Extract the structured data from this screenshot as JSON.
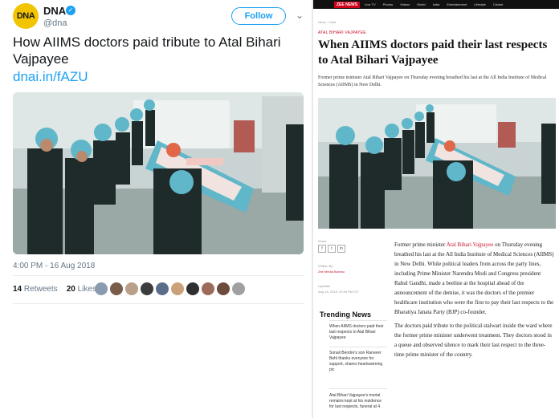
{
  "tweet": {
    "avatar_text": "DNA",
    "author_name": "DNA",
    "verified_glyph": "✓",
    "handle": "@dna",
    "follow_label": "Follow",
    "chevron_glyph": "⌄",
    "text": "How AIIMS doctors paid tribute to Atal Bihari Vajpayee",
    "link": "dnai.in/fAZU",
    "timestamp": "4:00 PM - 16 Aug 2018",
    "retweets_count": "14",
    "retweets_label": "Retweets",
    "likes_count": "20",
    "likes_label": "Likes",
    "liker_colors": [
      "#8a9bb0",
      "#7a5c4a",
      "#b8a08a",
      "#3c3c3c",
      "#5a6e8c",
      "#c9a27a",
      "#2f2f2f",
      "#9c6b5a",
      "#6d4c3d",
      "#a0a0a0"
    ]
  },
  "article": {
    "nav_logo": "ZEE NEWS",
    "nav_items": [
      "Live TV",
      "Photos",
      "Videos",
      "World",
      "India",
      "Entertainment",
      "Lifestyle",
      "Cricket"
    ],
    "breadcrumb": "News › India",
    "section": "ATAL BIHARI VAJPAYEE",
    "headline": "When AIIMS doctors paid their last respects to Atal Bihari Vajpayee",
    "summary": "Former prime minister Atal Bihari Vajpayee on Thursday evening breathed his last at the All India Institute of Medical Sciences (AIIMS) in New Delhi.",
    "share_label": "Share",
    "share_icons": [
      "f",
      "t",
      "in"
    ],
    "written_by_label": "Written By",
    "author": "Zee Media Bureau",
    "updated_label": "Updated",
    "updated_time": "Aug 16, 2018, 23:08 PM IST",
    "trending_heading": "Trending News",
    "trending": [
      "When AIIMS doctors paid their last respects to Atal Bihari Vajpayee",
      "Sonali Bendre's son Ranveer Behl thanks everyone for support, shares heartwarming pic",
      "Atal Bihari Vajpayee's mortal remains kept at his residence for last respects, funeral at 4"
    ],
    "body_p1_pre": "Former prime minister ",
    "body_p1_link": "Atal Bihari Vajpayee",
    "body_p1_post": " on Thursday evening breathed his last at the All India Institute of Medical Sciences (AIIMS) in New Delhi. While political leaders from across the party lines, including Prime Minister Narendra Modi and Congress president Rahul Gandhi, made a beeline at the hospital ahead of the announcement of the demise, it was the doctors of the premier healthcare institution who were the first to pay their last respects to the Bharatiya Janata Party (BJP) co-founder.",
    "body_p2": "The doctors paid tribute to the political stalwart inside the ward where the former prime minister underwent treatment. They doctors stood in a queue and observed silence to mark their last respect to the three-time prime minister of the country."
  },
  "colors": {
    "twitter_blue": "#1da1f2",
    "zee_red": "#c8102e",
    "scrub_teal": "#5fb7c9",
    "scrub_dark": "#1f2a2b"
  }
}
